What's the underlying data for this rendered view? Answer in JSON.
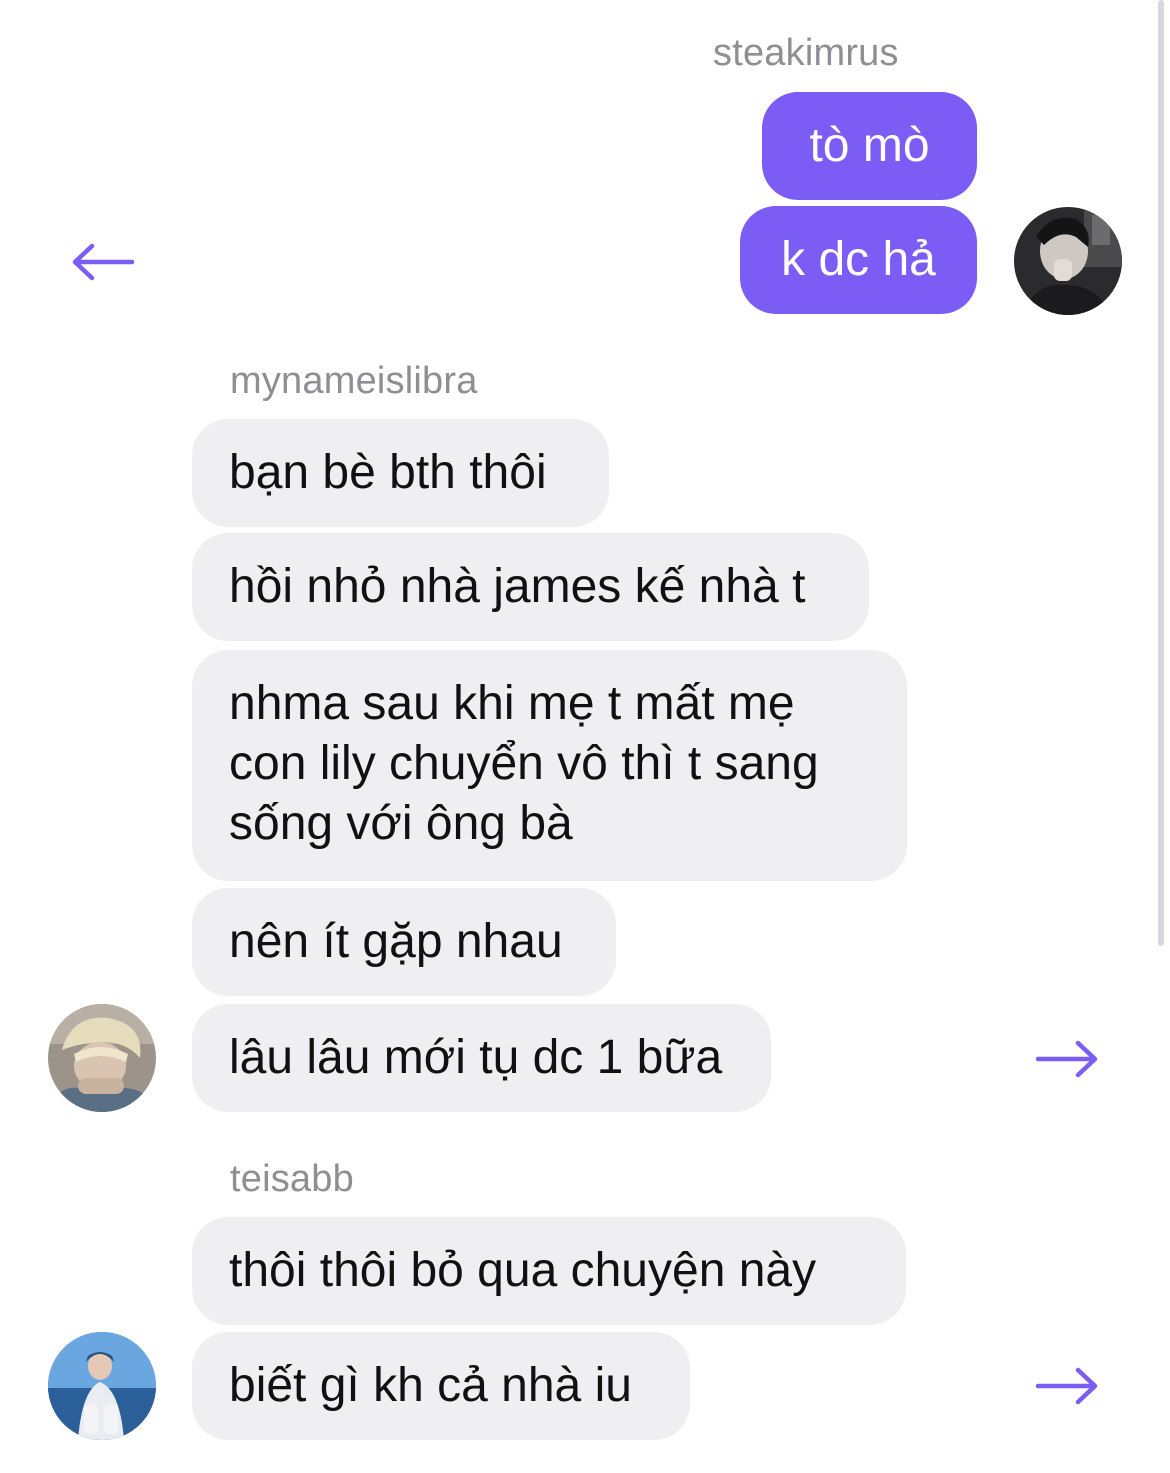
{
  "accent_color": "#7b5cf5",
  "incoming_bubble_color": "#efeff2",
  "groups": [
    {
      "sender": "steakimrus",
      "direction": "outgoing",
      "avatar": "avatar-dark-photo",
      "messages": [
        "tò mò",
        "k dc hả"
      ]
    },
    {
      "sender": "mynameislibra",
      "direction": "incoming",
      "avatar": "avatar-blond-photo",
      "messages": [
        "bạn bè bth thôi",
        "hồi nhỏ nhà james kế nhà t",
        "nhma sau khi mẹ t mất mẹ\ncon lily chuyển vô thì t sang\nsống với ông bà",
        "nên ít gặp nhau",
        "lâu lâu mới tụ dc 1 bữa"
      ]
    },
    {
      "sender": "teisabb",
      "direction": "incoming",
      "avatar": "avatar-sea-photo",
      "messages": [
        "thôi thôi bỏ qua chuyện này",
        "biết gì kh cả nhà iu"
      ]
    }
  ],
  "icons": {
    "back_arrow": "arrow-left-icon",
    "forward_arrow": "arrow-right-icon"
  }
}
